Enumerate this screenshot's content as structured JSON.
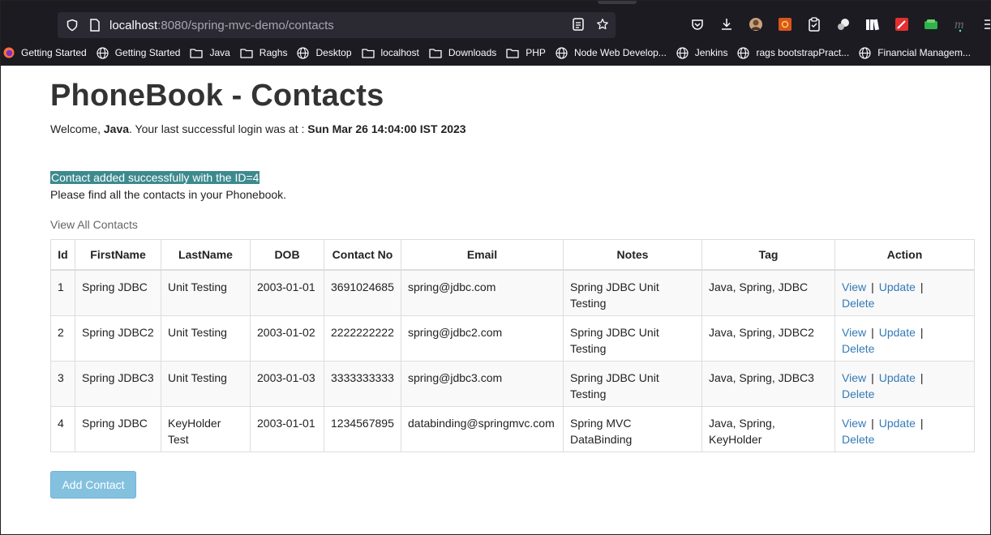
{
  "browser": {
    "url_host": "localhost",
    "url_rest": ":8080/spring-mvc-demo/contacts",
    "bookmarks": [
      {
        "label": "Getting Started",
        "icon": "firefox-icon"
      },
      {
        "label": "Getting Started",
        "icon": "globe-icon"
      },
      {
        "label": "Java",
        "icon": "folder-icon"
      },
      {
        "label": "Raghs",
        "icon": "folder-icon"
      },
      {
        "label": "Desktop",
        "icon": "globe-icon"
      },
      {
        "label": "localhost",
        "icon": "folder-icon"
      },
      {
        "label": "Downloads",
        "icon": "folder-icon"
      },
      {
        "label": "PHP",
        "icon": "folder-icon"
      },
      {
        "label": "Node Web Develop...",
        "icon": "globe-icon"
      },
      {
        "label": "Jenkins",
        "icon": "globe-icon"
      },
      {
        "label": "rags bootstrapPract...",
        "icon": "globe-icon"
      },
      {
        "label": "Financial Managem...",
        "icon": "globe-icon"
      }
    ]
  },
  "page": {
    "title": "PhoneBook - Contacts",
    "welcome_prefix": "Welcome, ",
    "user": "Java",
    "welcome_mid": ". Your last successful login was at : ",
    "last_login": "Sun Mar 26 14:04:00 IST 2023",
    "success_message": "Contact added successfully with the ID=4",
    "info": "Please find all the contacts in your Phonebook.",
    "view_all": "View All Contacts",
    "add_button": "Add Contact"
  },
  "table": {
    "headers": [
      "Id",
      "FirstName",
      "LastName",
      "DOB",
      "Contact No",
      "Email",
      "Notes",
      "Tag",
      "Action"
    ],
    "action_labels": {
      "view": "View",
      "update": "Update",
      "delete": "Delete",
      "sep": "|"
    },
    "rows": [
      {
        "id": "1",
        "first": "Spring JDBC",
        "last": "Unit Testing",
        "dob": "2003-01-01",
        "phone": "3691024685",
        "email": "spring@jdbc.com",
        "notes": "Spring JDBC Unit Testing",
        "tag": "Java, Spring, JDBC"
      },
      {
        "id": "2",
        "first": "Spring JDBC2",
        "last": "Unit Testing",
        "dob": "2003-01-02",
        "phone": "2222222222",
        "email": "spring@jdbc2.com",
        "notes": "Spring JDBC Unit Testing",
        "tag": "Java, Spring, JDBC2"
      },
      {
        "id": "3",
        "first": "Spring JDBC3",
        "last": "Unit Testing",
        "dob": "2003-01-03",
        "phone": "3333333333",
        "email": "spring@jdbc3.com",
        "notes": "Spring JDBC Unit Testing",
        "tag": "Java, Spring, JDBC3"
      },
      {
        "id": "4",
        "first": "Spring JDBC",
        "last": "KeyHolder Test",
        "dob": "2003-01-01",
        "phone": "1234567895",
        "email": "databinding@springmvc.com",
        "notes": "Spring MVC DataBinding",
        "tag": "Java, Spring, KeyHolder"
      }
    ]
  }
}
